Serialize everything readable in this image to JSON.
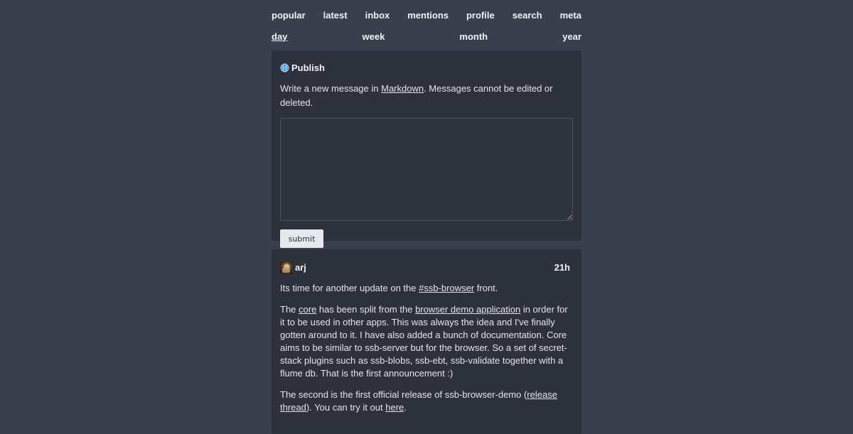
{
  "nav": {
    "items": [
      "popular",
      "latest",
      "inbox",
      "mentions",
      "profile",
      "search",
      "meta"
    ]
  },
  "period": {
    "items": [
      "day",
      "week",
      "month",
      "year"
    ],
    "active": "day"
  },
  "publish": {
    "title": "Publish",
    "icon": "globe-icon",
    "desc_prefix": "Write a new message in ",
    "desc_link": "Markdown",
    "desc_suffix": ". Messages cannot be edited or deleted.",
    "textarea_value": "",
    "submit_label": "submit"
  },
  "post": {
    "author": "arj",
    "time": "21h",
    "p1_a": "Its time for another update on the ",
    "p1_link": "#ssb-browser",
    "p1_b": " front.",
    "p2_a": "The ",
    "p2_link1": "core",
    "p2_b": " has been split from the ",
    "p2_link2": "browser demo application",
    "p2_c": " in order for it to be used in other apps. This was always the idea and I've finally gotten around to it. I have also added a bunch of documentation. Core aims to be similar to ssb-server but for the browser. So a set of secret-stack plugins such as ssb-blobs, ssb-ebt, ssb-validate together with a flume db. That is the first announcement :)",
    "p3_a": "The second is the first official release of ssb-browser-demo (",
    "p3_link1": "release thread",
    "p3_b": "). You can try it out ",
    "p3_link2": "here",
    "p3_c": "."
  },
  "colors": {
    "background": "#3a3f4d",
    "card": "#2d313c",
    "text": "#e3e5ea",
    "button": "#e6e8ec"
  }
}
